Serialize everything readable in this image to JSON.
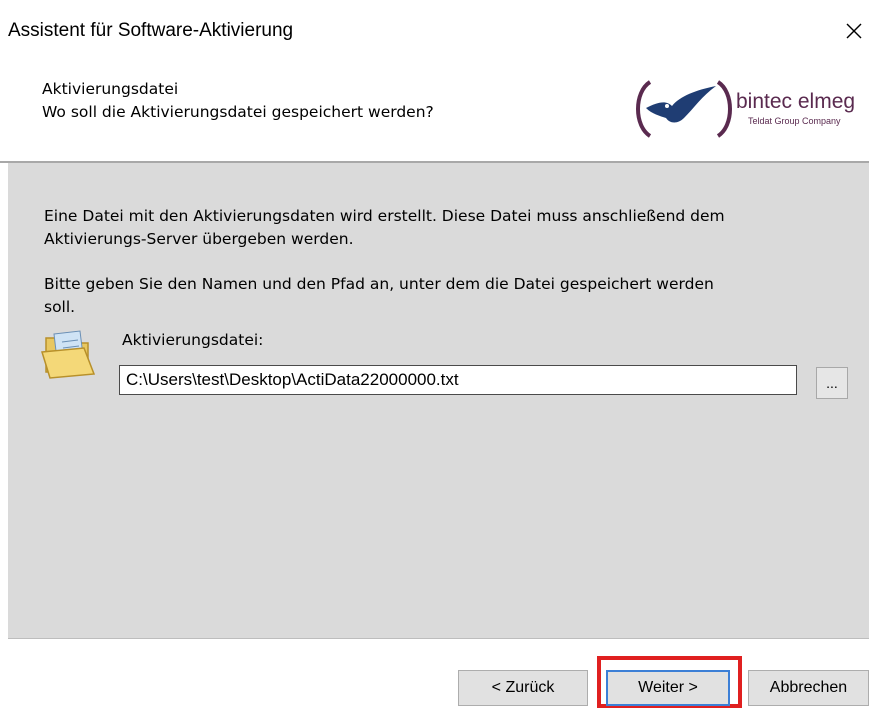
{
  "window": {
    "title": "Assistent für Software-Aktivierung",
    "close_glyph": "✕"
  },
  "header": {
    "title": "Aktivierungsdatei",
    "subtitle": "Wo soll die Aktivierungsdatei gespeichert werden?",
    "logo": {
      "brand": "bintec elmeg",
      "tagline": "Teldat Group Company",
      "colors": {
        "brand_purple": "#5a2a4f",
        "bird_navy": "#1f3d73"
      }
    }
  },
  "content": {
    "intro_line1": "Eine Datei mit den Aktivierungsdaten wird erstellt. Diese Datei muss anschließend dem",
    "intro_line2": "Aktivierungs-Server übergeben werden.",
    "instruction_line1": "Bitte geben Sie den Namen und den Pfad an, unter dem die Datei gespeichert werden",
    "instruction_line2": "soll.",
    "field_label": "Aktivierungsdatei:",
    "path_value": "C:\\Users\\test\\Desktop\\ActiData22000000.txt",
    "browse_label": "...",
    "icon": "open-folder-icon"
  },
  "footer": {
    "back_label": "< Zurück",
    "next_label": "Weiter >",
    "cancel_label": "Abbrechen"
  },
  "colors": {
    "content_bg": "#dadada",
    "highlight": "#e02020",
    "focus_border": "#3c7fd6"
  }
}
